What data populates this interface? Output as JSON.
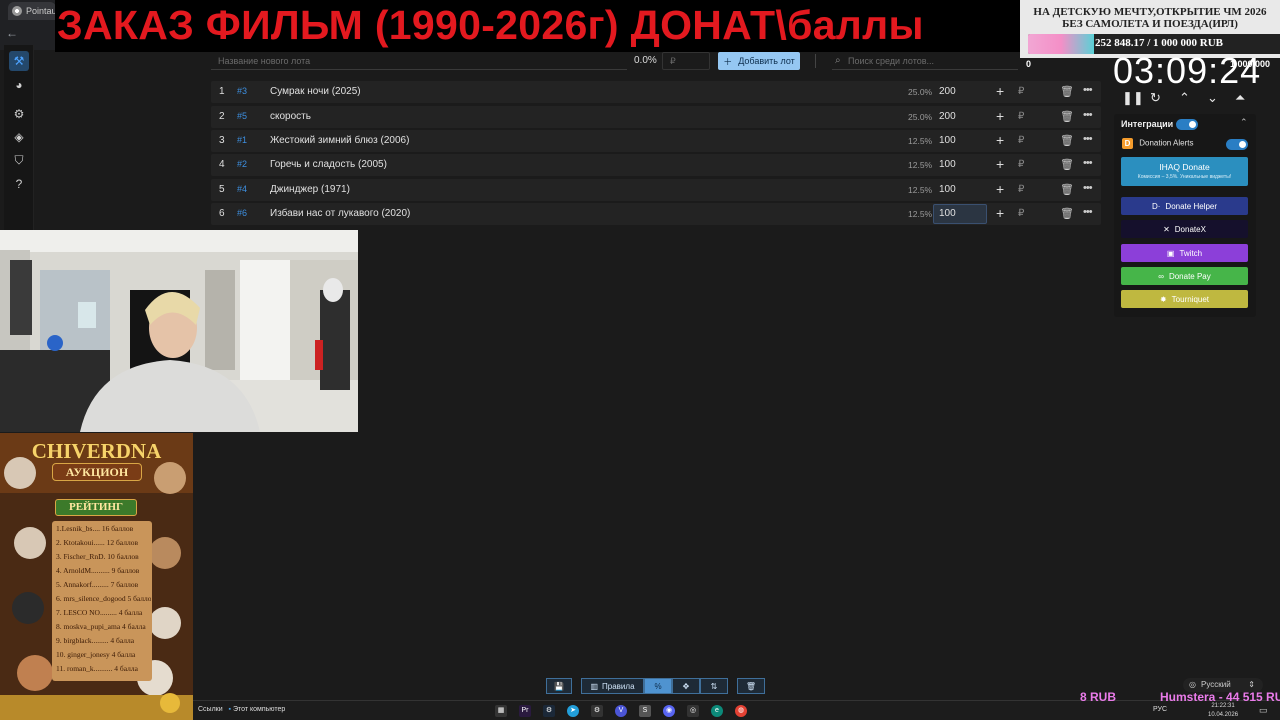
{
  "browser": {
    "tab_title": "Pointau"
  },
  "banner": {
    "text": "ЗАКАЗ ФИЛЬМ (1990-2026г) ДОНАТ\\баллы"
  },
  "goal": {
    "title": "НА ДЕТСКУЮ МЕЧТУ,ОТКРЫТИЕ ЧМ 2026 БЕЗ САМОЛЕТА И ПОЕЗДА(ИРЛ)",
    "amount": "252 848.17 / 1 000 000 RUB",
    "progress": 0.253,
    "min_label": "0",
    "max_label": "1 000 000"
  },
  "toolbar": {
    "lot_name_placeholder": "Название нового лота",
    "percent": "0.0%",
    "rub_placeholder": "₽",
    "add_lot_label": "Добавить лот",
    "search_placeholder": "Поиск среди лотов..."
  },
  "lots": [
    {
      "idx": "1",
      "hash": "#3",
      "name": "Сумрак ночи (2025)",
      "pct": "25.0%",
      "amount": "200"
    },
    {
      "idx": "2",
      "hash": "#5",
      "name": "скорость",
      "pct": "25.0%",
      "amount": "200"
    },
    {
      "idx": "3",
      "hash": "#1",
      "name": " Жестокий зимний блюз (2006)",
      "pct": "12.5%",
      "amount": "100"
    },
    {
      "idx": "4",
      "hash": "#2",
      "name": "Горечь и сладость (2005)",
      "pct": "12.5%",
      "amount": "100"
    },
    {
      "idx": "5",
      "hash": "#4",
      "name": "Джинджер (1971)",
      "pct": "12.5%",
      "amount": "100"
    },
    {
      "idx": "6",
      "hash": "#6",
      "name": "Избави нас от лукавого (2020)",
      "pct": "12.5%",
      "amount": "100"
    }
  ],
  "lot_currency": "₽",
  "timer": {
    "value": "03:09:24"
  },
  "integrations": {
    "title": "Интеграции",
    "donation_alerts": "Donation Alerts",
    "ihaq_title": "IHAQ Donate",
    "ihaq_sub": "Комиссия – 3,5%. Уникальные виджеты!",
    "services": [
      "Donate Helper",
      "DonateX",
      "Twitch",
      "Donate Pay",
      "Tourniquet"
    ]
  },
  "rating": {
    "title": "CHIVERDNA",
    "subtitle": "АУКЦИОН",
    "banner": "РЕЙТИНГ",
    "entries": [
      "1.Lesnik_bs.... 16 баллов",
      "2. Ktotakoui...... 12 баллов",
      "3. Fischer_RnD. 10 баллов",
      "4. ArnoldM.......... 9 баллов",
      "5. Annakorf......... 7 баллов",
      "6. mrs_silence_dogood 5 баллов",
      "7. LESCO NO......... 4 балла",
      "8. moskva_pupi_ama 4 балла",
      "9. birgblack......... 4 балла",
      "10. ginger_jonesy 4 балла",
      "11. roman_k.......... 4 балла"
    ]
  },
  "bottom_toolbar": {
    "rules_label": "Правила"
  },
  "language": {
    "selected": "Русский"
  },
  "taskbar": {
    "links": "Ссылки",
    "computer": "Этот компьютер",
    "lang": "РУС",
    "time": "21:22:31",
    "date": "10.04.2026"
  },
  "tickers": {
    "left": "8 RUB",
    "right": "Humstera - 44 515 RU"
  },
  "colors": {
    "accent": "#4da3ff",
    "banner_red": "#e3191f",
    "donate_helper": "#2a3a8c",
    "donatex": "#15102c",
    "twitch": "#8c3fd9",
    "donate_pay": "#46b549",
    "tourniquet": "#bfb840"
  }
}
